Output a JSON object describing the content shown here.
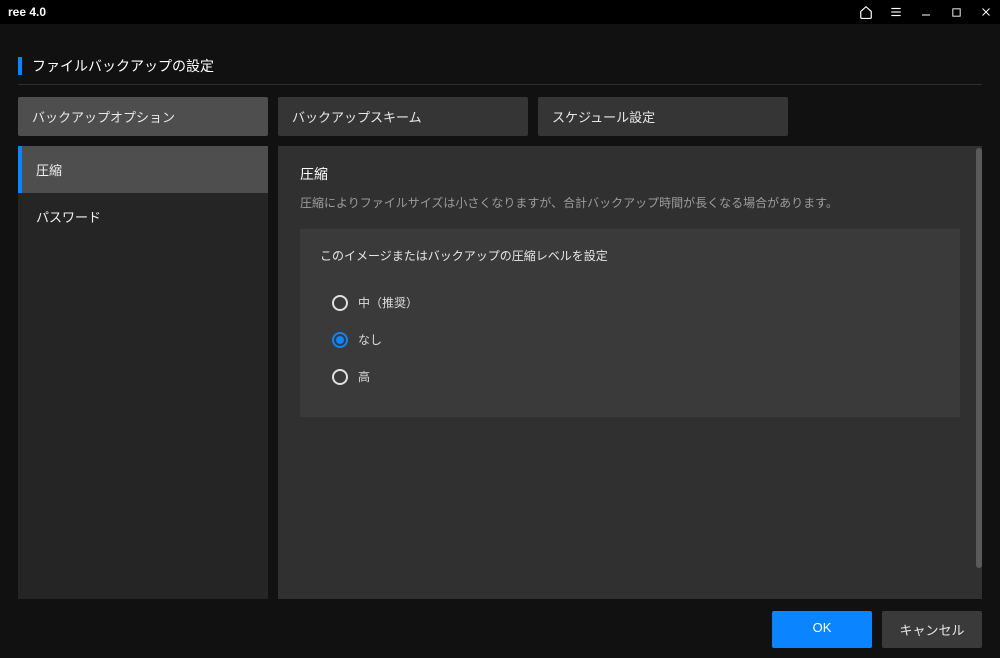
{
  "titlebar": {
    "appTitle": "ree 4.0"
  },
  "header": {
    "title": "ファイルバックアップの設定"
  },
  "tabs": [
    {
      "label": "バックアップオプション",
      "active": true
    },
    {
      "label": "バックアップスキーム",
      "active": false
    },
    {
      "label": "スケジュール設定",
      "active": false
    }
  ],
  "sidebar": {
    "items": [
      {
        "label": "圧縮",
        "active": true
      },
      {
        "label": "パスワード",
        "active": false
      }
    ]
  },
  "panel": {
    "title": "圧縮",
    "description": "圧縮によりファイルサイズは小さくなりますが、合計バックアップ時間が長くなる場合があります。",
    "group_title": "このイメージまたはバックアップの圧縮レベルを設定",
    "options": [
      {
        "label": "中（推奨）",
        "selected": false
      },
      {
        "label": "なし",
        "selected": true
      },
      {
        "label": "高",
        "selected": false
      }
    ]
  },
  "footer": {
    "ok": "OK",
    "cancel": "キャンセル"
  }
}
